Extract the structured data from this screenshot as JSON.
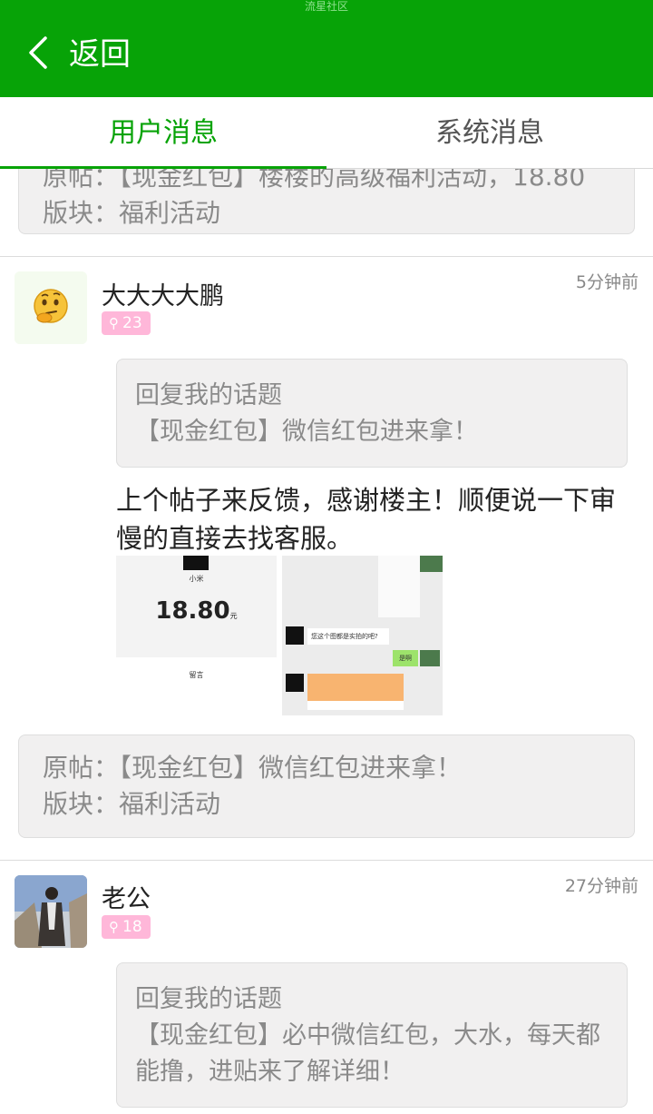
{
  "app_title": "流星社区",
  "header": {
    "back_label": "返回"
  },
  "tabs": [
    {
      "label": "用户消息",
      "active": true
    },
    {
      "label": "系统消息",
      "active": false
    }
  ],
  "prev_item": {
    "original_post_partial": "原帖：【现金红包】楼楼的高级福利活动，18.80",
    "section": "版块：福利活动"
  },
  "messages": [
    {
      "username": "大大大大鹏",
      "time": "5分钟前",
      "level": "23",
      "quote_title": "回复我的话题",
      "quote_text": "【现金红包】微信红包进来拿！",
      "reply": "上个帖子来反馈，感谢楼主！顺便说一下审慢的直接去找客服。",
      "images": [
        {
          "amount": "18.80",
          "unit": "元",
          "name": "小米",
          "footer": "留言"
        },
        {
          "chat_text": "您这个图都是实拍的吧?",
          "reply_bubble": "是啊"
        }
      ],
      "original_post": "原帖：【现金红包】微信红包进来拿！",
      "section": "版块：福利活动"
    },
    {
      "username": "老公",
      "time": "27分钟前",
      "level": "18",
      "quote_title": "回复我的话题",
      "quote_text": "【现金红包】必中微信红包，大水，每天都能撸，进贴来了解详细！"
    }
  ],
  "colors": {
    "brand_green": "#07a307",
    "level_badge": "#ffb7d9",
    "box_bg": "#f1f0f0"
  }
}
